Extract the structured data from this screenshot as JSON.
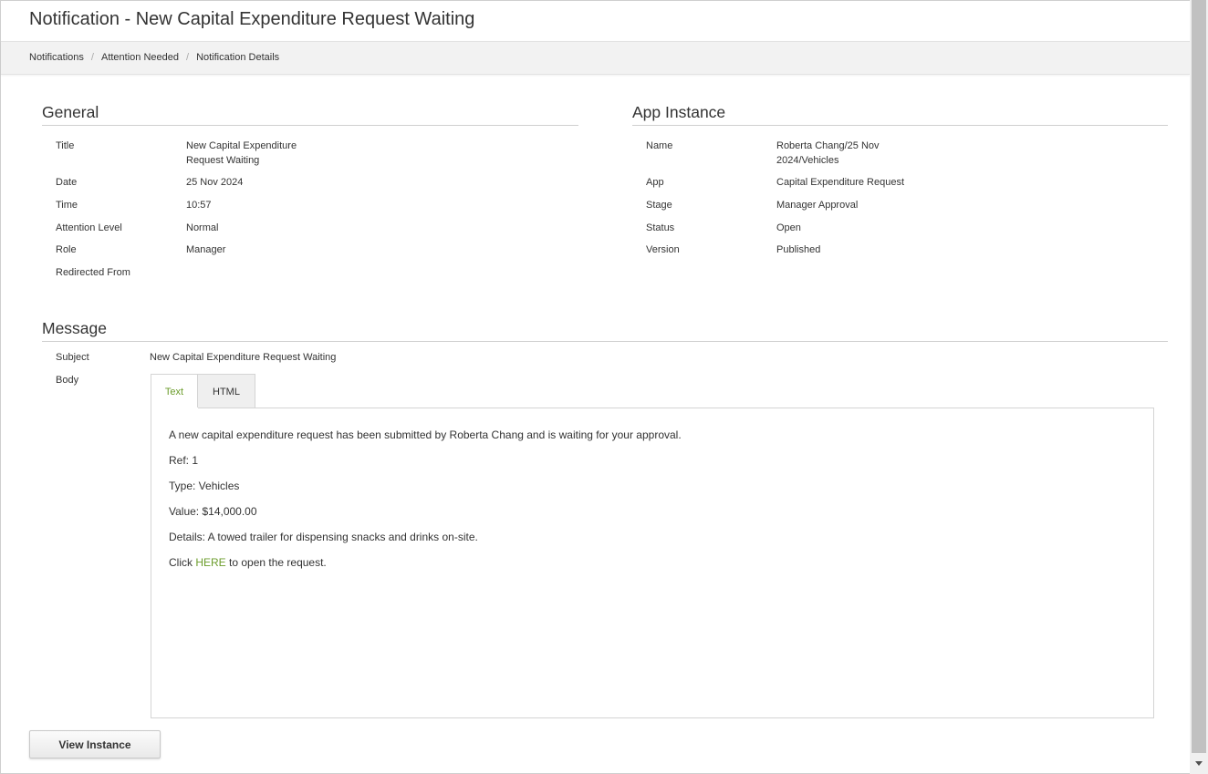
{
  "page": {
    "title": "Notification - New Capital Expenditure Request Waiting"
  },
  "breadcrumb": {
    "items": [
      "Notifications",
      "Attention Needed",
      "Notification Details"
    ],
    "separator": "/"
  },
  "general": {
    "heading": "General",
    "fields": [
      {
        "label": "Title",
        "value_line1": "New Capital Expenditure",
        "value_line2": "Request Waiting"
      },
      {
        "label": "Date",
        "value": "25 Nov 2024"
      },
      {
        "label": "Time",
        "value": "10:57"
      },
      {
        "label": "Attention Level",
        "value": "Normal"
      },
      {
        "label": "Role",
        "value": "Manager"
      },
      {
        "label": "Redirected From",
        "value": ""
      }
    ]
  },
  "app_instance": {
    "heading": "App Instance",
    "fields": [
      {
        "label": "Name",
        "value_line1": "Roberta Chang/25 Nov",
        "value_line2": "2024/Vehicles"
      },
      {
        "label": "App",
        "value": "Capital Expenditure Request"
      },
      {
        "label": "Stage",
        "value": "Manager Approval"
      },
      {
        "label": "Status",
        "value": "Open"
      },
      {
        "label": "Version",
        "value": "Published"
      }
    ]
  },
  "message": {
    "heading": "Message",
    "subject_label": "Subject",
    "subject_value": "New Capital Expenditure Request Waiting",
    "body_label": "Body",
    "tabs": [
      "Text",
      "HTML"
    ],
    "active_tab": "Text",
    "body_lines": [
      "A new capital expenditure request has been submitted by Roberta Chang and is waiting for your approval.",
      "Ref: 1",
      "Type: Vehicles",
      "Value: $14,000.00",
      "Details: A towed trailer for dispensing snacks and drinks on-site."
    ],
    "click_prefix": "Click ",
    "click_link": "HERE",
    "click_suffix": " to open the request."
  },
  "actions": {
    "view_instance_label": "View Instance"
  },
  "colors": {
    "accent_green": "#6b9c2b",
    "breadcrumb_bg": "#f2f2f2",
    "rule": "#cfcfcf"
  },
  "icons": {
    "scroll_down": "chevron-down-icon"
  }
}
